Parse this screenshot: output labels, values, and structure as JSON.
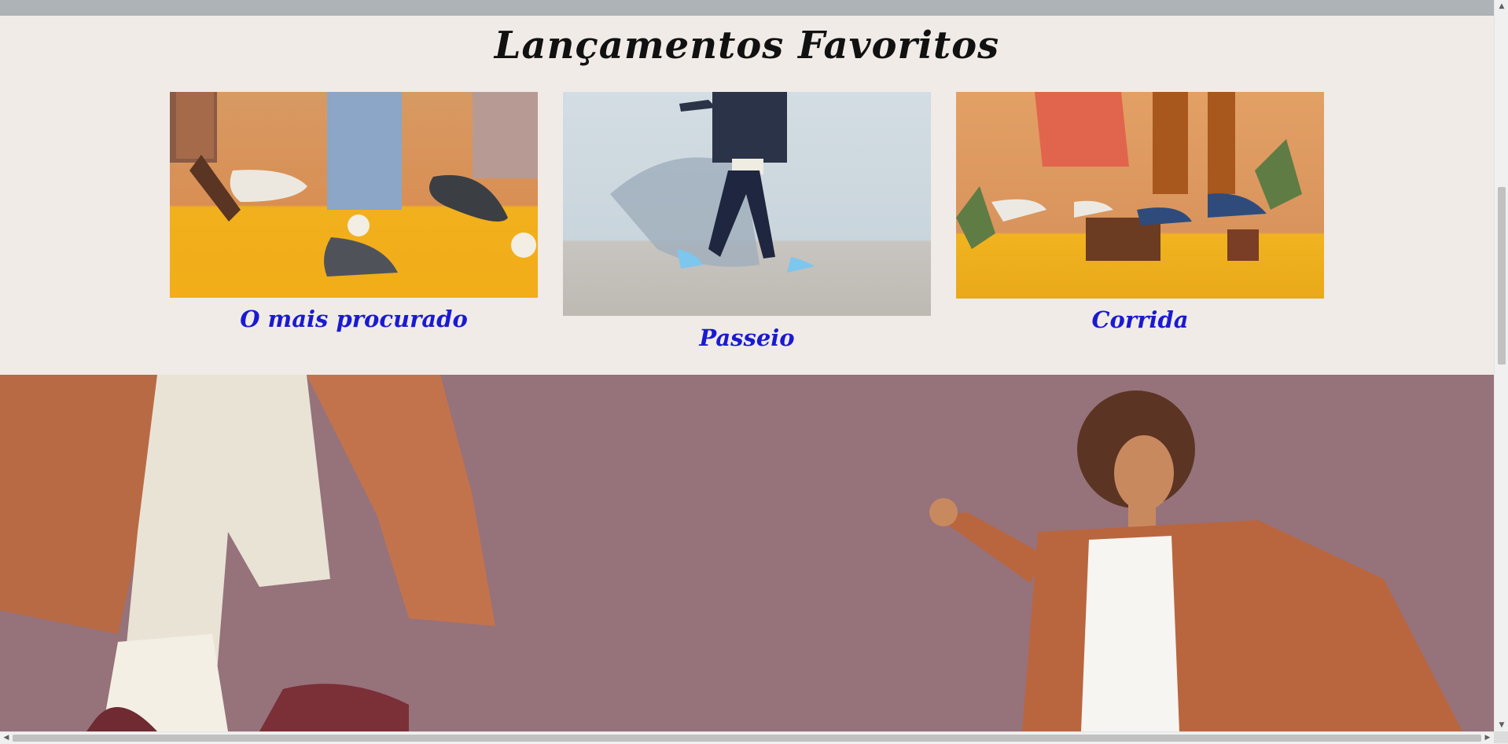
{
  "favorites": {
    "title": "Lançamentos Favoritos",
    "cards": [
      {
        "label": "O mais procurado",
        "image": "sneakers-on-feet-orange-yellow-backdrop"
      },
      {
        "label": "Passeio",
        "image": "person-walking-light-blue-sneakers"
      },
      {
        "label": "Corrida",
        "image": "sneakers-on-wood-stumps-with-plants"
      }
    ]
  },
  "hero": {
    "background": "#96727b",
    "image": "woman-in-rust-coat-dancing"
  },
  "colors": {
    "link": "#1a1ad1",
    "page_bg": "#f0ebe7",
    "topbar": "#adb3b6"
  }
}
